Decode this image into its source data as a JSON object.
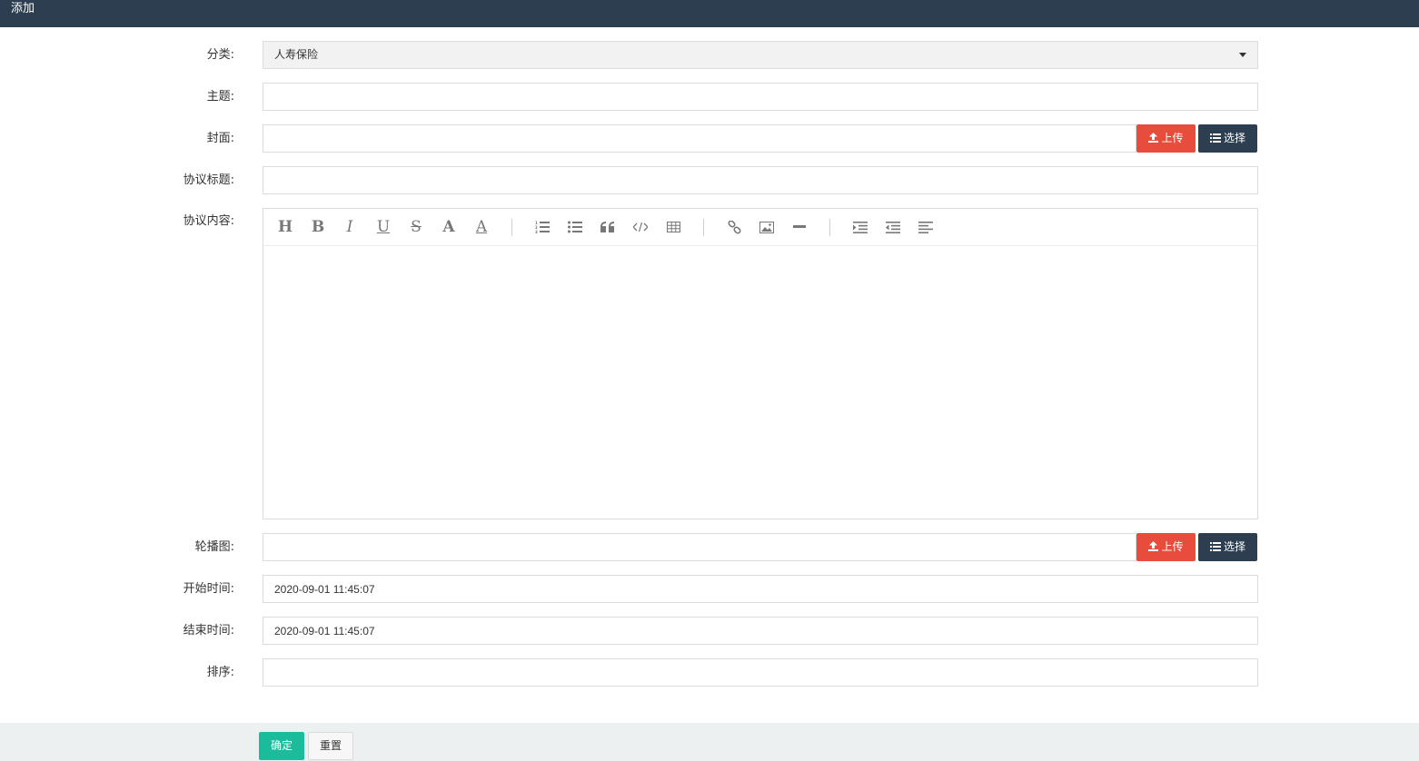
{
  "header": {
    "title": "添加"
  },
  "form": {
    "category": {
      "label": "分类:",
      "value": "人寿保险"
    },
    "subject": {
      "label": "主题:",
      "value": ""
    },
    "cover": {
      "label": "封面:",
      "value": "",
      "upload_label": "上传",
      "choose_label": "选择"
    },
    "agreement_title": {
      "label": "协议标题:",
      "value": ""
    },
    "agreement_content": {
      "label": "协议内容:",
      "toolbar": [
        "heading-icon",
        "bold-icon",
        "italic-icon",
        "underline-icon",
        "strikethrough-icon",
        "font-color-icon",
        "background-color-icon",
        "ordered-list-icon",
        "unordered-list-icon",
        "blockquote-icon",
        "code-icon",
        "table-icon",
        "link-icon",
        "image-icon",
        "hr-icon",
        "indent-icon",
        "outdent-icon",
        "align-icon"
      ]
    },
    "carousel": {
      "label": "轮播图:",
      "value": "",
      "upload_label": "上传",
      "choose_label": "选择"
    },
    "start_time": {
      "label": "开始时间:",
      "value": "2020-09-01 11:45:07"
    },
    "end_time": {
      "label": "结束时间:",
      "value": "2020-09-01 11:45:07"
    },
    "sort": {
      "label": "排序:",
      "value": ""
    }
  },
  "footer": {
    "confirm_label": "确定",
    "reset_label": "重置"
  },
  "colors": {
    "header_bg": "#2c3e50",
    "upload_button": "#e74c3c",
    "choose_button": "#2c3e50",
    "confirm_button": "#1abc9c",
    "footer_bg": "#ecf0f1"
  }
}
